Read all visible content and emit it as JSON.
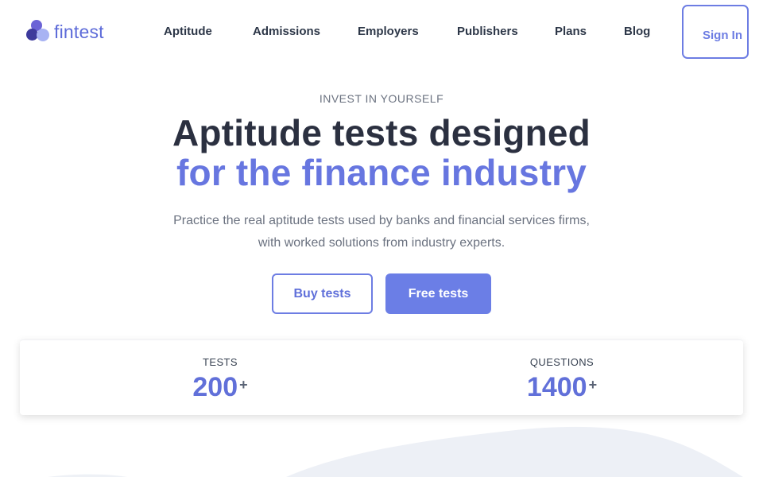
{
  "brand": {
    "name": "fintest"
  },
  "nav": {
    "items": [
      "Aptitude",
      "Admissions",
      "Employers",
      "Publishers",
      "Plans",
      "Blog"
    ],
    "signin_label": "Sign In"
  },
  "hero": {
    "eyebrow": "INVEST IN YOURSELF",
    "headline_line1": "Aptitude tests designed",
    "headline_line2": "for the finance industry",
    "subtext_line1": "Practice the real aptitude tests used by banks and financial services firms,",
    "subtext_line2": "with worked solutions from industry experts.",
    "buy_label": "Buy tests",
    "free_label": "Free tests"
  },
  "stats": [
    {
      "label": "TESTS",
      "value": "200",
      "suffix": "+"
    },
    {
      "label": "QUESTIONS",
      "value": "1400",
      "suffix": "+"
    }
  ],
  "colors": {
    "accent": "#6b7ee6",
    "heading": "#2b3040",
    "muted": "#6b7280",
    "logo_dark": "#3d3a9c",
    "logo_mid": "#6b63d6",
    "logo_light": "#a8b3f3",
    "wave": "#edf0f6"
  }
}
